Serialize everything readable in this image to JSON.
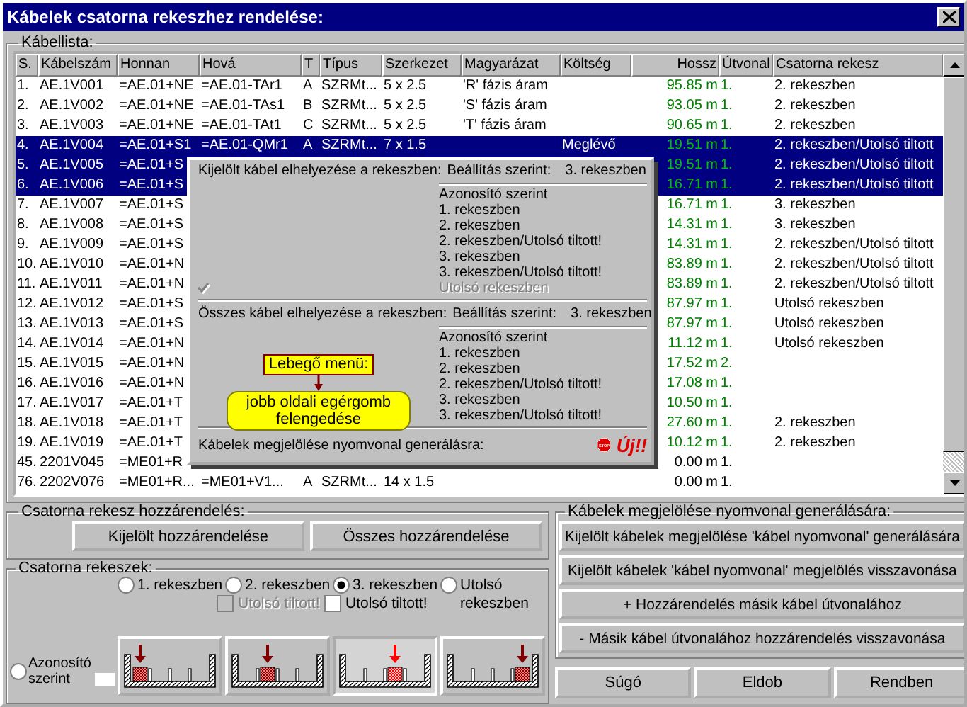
{
  "window": {
    "title": "Kábelek csatorna rekeszhez rendelése:"
  },
  "cable_list": {
    "label": "Kábellista:",
    "columns": [
      "S.",
      "Kábelszám",
      "Honnan",
      "Hová",
      "T",
      "Típus",
      "Szerkezet",
      "Magyarázat",
      "Költség",
      "Hossz",
      "Útvonal",
      "Csatorna rekesz"
    ],
    "rows": [
      {
        "selected": false,
        "routed": true,
        "cells": [
          "1.",
          "AE.1V001",
          "=AE.01+NE",
          "=AE.01-TAr1",
          "A",
          "SZRMt...",
          "5 x 2.5",
          "'R' fázis áram",
          null,
          "95.85 m",
          "1.",
          "2. rekeszben"
        ]
      },
      {
        "selected": false,
        "routed": true,
        "cells": [
          "2.",
          "AE.1V002",
          "=AE.01+NE",
          "=AE.01-TAs1",
          "B",
          "SZRMt...",
          "5 x 2.5",
          "'S' fázis áram",
          null,
          "93.05 m",
          "1.",
          "2. rekeszben"
        ]
      },
      {
        "selected": false,
        "routed": true,
        "cells": [
          "3.",
          "AE.1V003",
          "=AE.01+NE",
          "=AE.01-TAt1",
          "C",
          "SZRMt...",
          "5 x 2.5",
          "'T' fázis áram",
          null,
          "90.65 m",
          "1.",
          "2. rekeszben"
        ]
      },
      {
        "selected": true,
        "routed": true,
        "cells": [
          "4.",
          "AE.1V004",
          "=AE.01+S1",
          "=AE.01-QMr1",
          "A",
          "SZRMt...",
          "7 x 1.5",
          null,
          "Meglévő",
          "19.51 m",
          "1.",
          "2. rekeszben/Utolsó tiltott"
        ]
      },
      {
        "selected": true,
        "routed": true,
        "cells": [
          "5.",
          "AE.1V005",
          "=AE.01+S",
          null,
          null,
          null,
          null,
          null,
          null,
          "19.51 m",
          "1.",
          "2. rekeszben/Utolsó tiltott"
        ]
      },
      {
        "selected": true,
        "routed": true,
        "cells": [
          "6.",
          "AE.1V006",
          "=AE.01+S",
          null,
          null,
          null,
          null,
          null,
          null,
          "16.71 m",
          "1.",
          "2. rekeszben/Utolsó tiltott"
        ]
      },
      {
        "selected": false,
        "routed": true,
        "cells": [
          "7.",
          "AE.1V007",
          "=AE.01+S",
          null,
          null,
          null,
          null,
          null,
          null,
          "16.71 m",
          "1.",
          "3. rekeszben"
        ]
      },
      {
        "selected": false,
        "routed": true,
        "cells": [
          "8.",
          "AE.1V008",
          "=AE.01+S",
          null,
          null,
          null,
          null,
          null,
          null,
          "14.31 m",
          "1.",
          "3. rekeszben"
        ]
      },
      {
        "selected": false,
        "routed": true,
        "cells": [
          "9.",
          "AE.1V009",
          "=AE.01+S",
          null,
          null,
          null,
          null,
          null,
          null,
          "14.31 m",
          "1.",
          "2. rekeszben/Utolsó tiltott"
        ]
      },
      {
        "selected": false,
        "routed": true,
        "cells": [
          "10.",
          "AE.1V010",
          "=AE.01+N",
          null,
          null,
          null,
          null,
          null,
          null,
          "83.89 m",
          "1.",
          "2. rekeszben/Utolsó tiltott"
        ]
      },
      {
        "selected": false,
        "routed": true,
        "cells": [
          "11.",
          "AE.1V011",
          "=AE.01+N",
          null,
          null,
          null,
          null,
          null,
          null,
          "83.89 m",
          "1.",
          "2. rekeszben/Utolsó tiltott"
        ]
      },
      {
        "selected": false,
        "routed": true,
        "cells": [
          "12.",
          "AE.1V012",
          "=AE.01+S",
          null,
          null,
          null,
          null,
          null,
          null,
          "87.97 m",
          "1.",
          "Utolsó rekeszben"
        ]
      },
      {
        "selected": false,
        "routed": true,
        "cells": [
          "13.",
          "AE.1V013",
          "=AE.01+S",
          null,
          null,
          null,
          null,
          null,
          null,
          "87.97 m",
          "1.",
          "Utolsó rekeszben"
        ]
      },
      {
        "selected": false,
        "routed": true,
        "cells": [
          "14.",
          "AE.1V014",
          "=AE.01+N",
          null,
          null,
          null,
          null,
          null,
          null,
          "11.12 m",
          "1.",
          "Utolsó rekeszben"
        ]
      },
      {
        "selected": false,
        "routed": true,
        "cells": [
          "15.",
          "AE.1V015",
          "=AE.01+N",
          null,
          null,
          null,
          null,
          null,
          null,
          "17.52 m",
          "2.",
          null
        ]
      },
      {
        "selected": false,
        "routed": true,
        "cells": [
          "16.",
          "AE.1V016",
          "=AE.01+N",
          null,
          null,
          null,
          null,
          null,
          null,
          "17.08 m",
          "1.",
          null
        ]
      },
      {
        "selected": false,
        "routed": true,
        "cells": [
          "17.",
          "AE.1V017",
          "=AE.01+T",
          null,
          null,
          null,
          null,
          null,
          null,
          "10.50 m",
          "1.",
          null
        ]
      },
      {
        "selected": false,
        "routed": true,
        "cells": [
          "18.",
          "AE.1V018",
          "=AE.01+T",
          null,
          null,
          null,
          null,
          null,
          null,
          "27.60 m",
          "1.",
          "2. rekeszben"
        ]
      },
      {
        "selected": false,
        "routed": true,
        "cells": [
          "19.",
          "AE.1V019",
          "=AE.01+T",
          null,
          null,
          null,
          null,
          null,
          null,
          "10.12 m",
          "1.",
          "2. rekeszben"
        ]
      },
      {
        "selected": false,
        "routed": false,
        "cells": [
          "45.",
          "2201V045",
          "=ME01+R",
          null,
          null,
          null,
          null,
          null,
          null,
          "0.00 m",
          "1.",
          null
        ]
      },
      {
        "selected": false,
        "routed": false,
        "cells": [
          "76.",
          "2202V076",
          "=ME01+R...",
          "=ME01+V1...",
          "A",
          "SZRMt...",
          "14 x 1.5",
          null,
          null,
          "0.00 m",
          "1.",
          null
        ]
      }
    ]
  },
  "popup_menu": {
    "sections": [
      {
        "heading": "Kijelölt kábel elhelyezése a rekeszben:",
        "setting_label": "Beállítás szerint:",
        "setting_value": "3. rekeszben",
        "items": [
          {
            "label": "Azonosító szerint",
            "checked": false,
            "disabled": false
          },
          {
            "label": "1. rekeszben",
            "checked": false,
            "disabled": false
          },
          {
            "label": "2. rekeszben",
            "checked": false,
            "disabled": false
          },
          {
            "label": "2. rekeszben/Utolsó tiltott!",
            "checked": false,
            "disabled": false
          },
          {
            "label": "3. rekeszben",
            "checked": false,
            "disabled": false
          },
          {
            "label": "3. rekeszben/Utolsó tiltott!",
            "checked": false,
            "disabled": false
          },
          {
            "label": "Utolsó rekeszben",
            "checked": true,
            "disabled": true
          }
        ]
      },
      {
        "heading": "Összes kábel elhelyezése a rekeszben:",
        "setting_label": "Beállítás szerint:",
        "setting_value": "3. rekeszben",
        "callout": {
          "title": "Lebegő menü:",
          "text": "jobb oldali egérgomb felengedése"
        },
        "items": [
          {
            "label": "Azonosító szerint",
            "checked": false,
            "disabled": false
          },
          {
            "label": "1. rekeszben",
            "checked": false,
            "disabled": false
          },
          {
            "label": "2. rekeszben",
            "checked": false,
            "disabled": false
          },
          {
            "label": "2. rekeszben/Utolsó tiltott!",
            "checked": false,
            "disabled": false
          },
          {
            "label": "3. rekeszben",
            "checked": false,
            "disabled": false
          },
          {
            "label": "3. rekeszben/Utolsó tiltott!",
            "checked": false,
            "disabled": false
          }
        ]
      }
    ],
    "footer": {
      "label": "Kábelek megjelölése nyomvonal generálásra:",
      "stop_sign": "STOP",
      "badge": "Új!!"
    }
  },
  "assign_group": {
    "label": "Csatorna rekesz hozzárendelés:",
    "buttons": [
      "Kijelölt hozzárendelése",
      "Összes hozzárendelése"
    ]
  },
  "compartments_group": {
    "label": "Csatorna rekeszek:",
    "by_id": {
      "label": "Azonosító szerint",
      "selected": false
    },
    "slots": [
      {
        "label": "1. rekeszben",
        "selected": false
      },
      {
        "label": "2. rekeszben",
        "selected": false,
        "checkbox": {
          "label": "Utolsó tiltott!",
          "checked": false,
          "disabled": true
        }
      },
      {
        "label": "3. rekeszben",
        "selected": true,
        "checkbox": {
          "label": "Utolsó tiltott!",
          "checked": false,
          "disabled": false
        }
      },
      {
        "label": "Utolsó rekeszben",
        "selected": false
      }
    ]
  },
  "mark_group": {
    "label": "Kábelek megjelölése nyomvonal generálására:",
    "buttons": [
      "Kijelölt kábelek megjelölése 'kábel nyomvonal' generálására",
      "Kijelölt kábelek 'kábel nyomvonal' megjelölés visszavonása",
      "+ Hozzárendelés másik kábel útvonalához",
      "- Másik kábel útvonalához hozzárendelés visszavonása"
    ]
  },
  "footer_buttons": [
    "Súgó",
    "Eldob",
    "Rendben"
  ]
}
